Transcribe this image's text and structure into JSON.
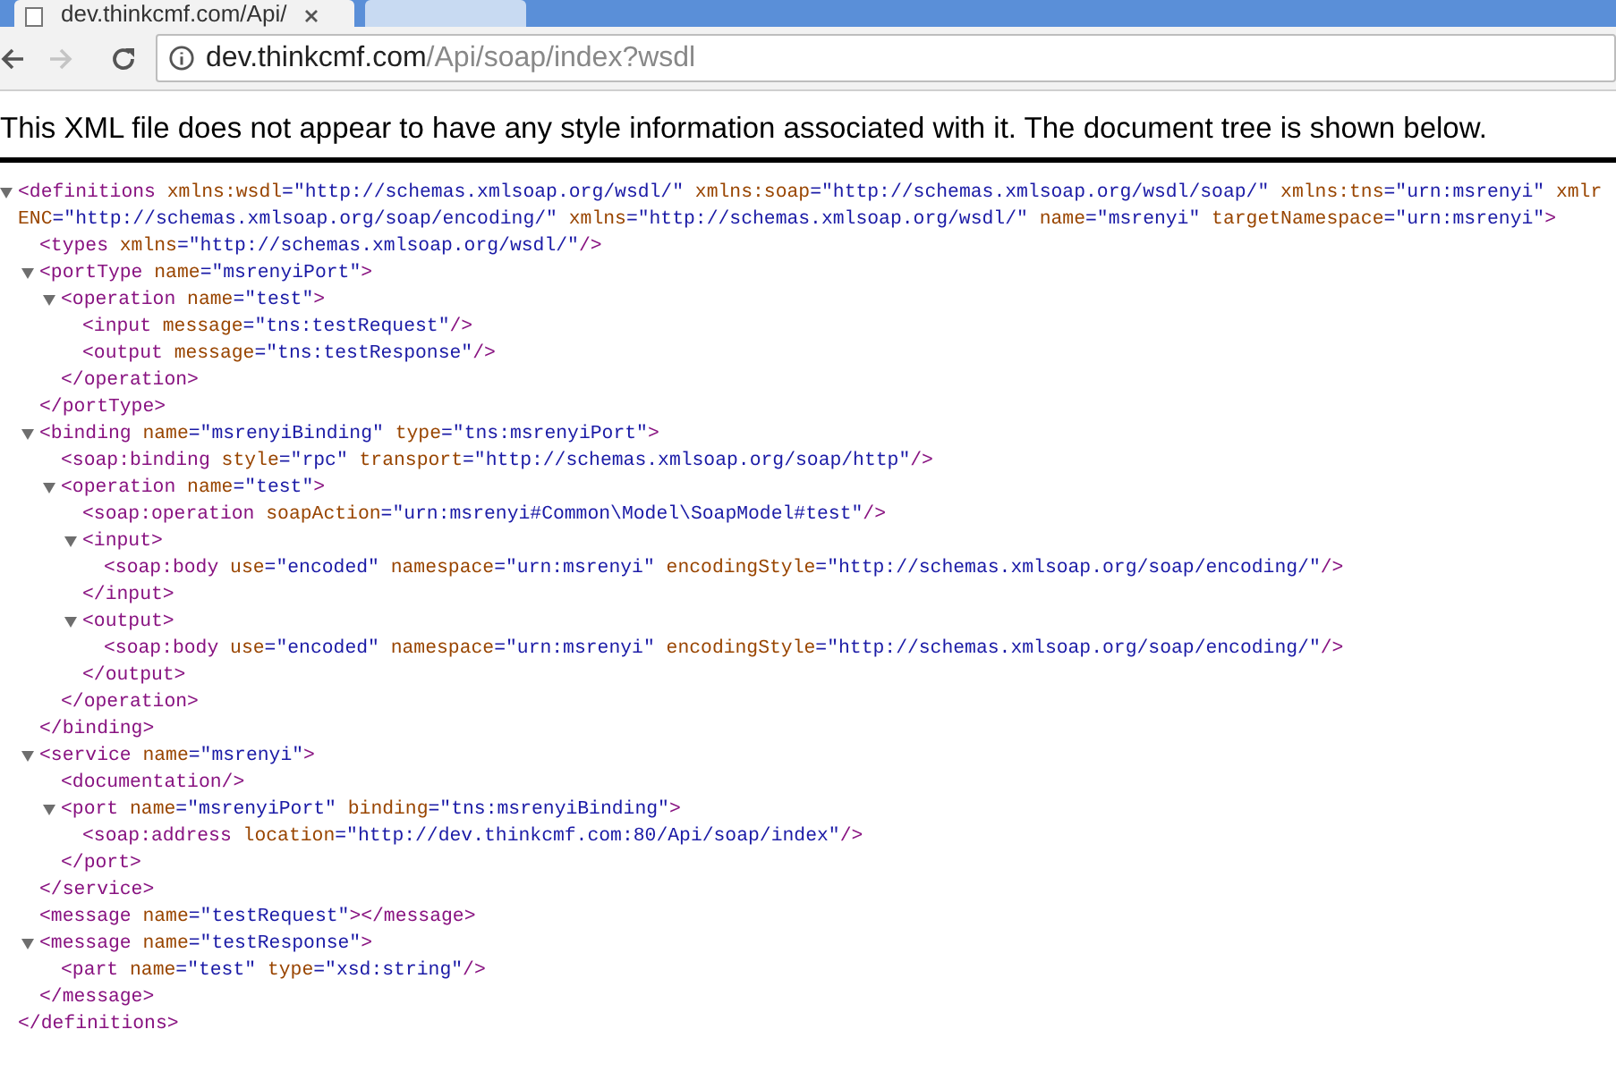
{
  "tab": {
    "title": "dev.thinkcmf.com/Api/"
  },
  "address_bar": {
    "host": "dev.thinkcmf.com",
    "path": "/Api/soap/index?wsdl"
  },
  "navigation": {
    "back_disabled": false,
    "forward_disabled": true
  },
  "notice": "This XML file does not appear to have any style information associated with it. The document tree is shown below.",
  "xml_tree": [
    {
      "tag_open": "<definitions",
      "attributes": [
        {
          "name": "xmlns:wsdl",
          "value": "=\"http://schemas.xmlsoap.org/wsdl/\"",
          "line_break": false
        },
        {
          "name": "xmlns:soap",
          "value": "=\"http://schemas.xmlsoap.org/wsdl/soap/\"",
          "line_break": false
        },
        {
          "name": "xmlns:tns",
          "value": "=\"urn:msrenyi\"",
          "line_break": false
        },
        {
          "name": "xmlr",
          "line_break": false
        },
        {
          "name": "ENC",
          "value": "=\"http://schemas.xmlsoap.org/soap/encoding/\"",
          "line_break": true
        },
        {
          "name": "xmlns",
          "value": "=\"http://schemas.xmlsoap.org/wsdl/\"",
          "line_break": false
        },
        {
          "name": "name",
          "value": "=\"msrenyi\"",
          "line_break": false
        },
        {
          "name": "targetNamespace",
          "value": "=\"urn:msrenyi\"",
          "line_break": false
        }
      ],
      "tag_end": ">",
      "expanded": true,
      "close": "</definitions>",
      "children": [
        {
          "tag_open": "<types",
          "attributes": [
            {
              "name": "xmlns",
              "value": "=\"http://schemas.xmlsoap.org/wsdl/\"",
              "line_break": false
            }
          ],
          "tag_end": "/>"
        },
        {
          "tag_open": "<portType",
          "attributes": [
            {
              "name": "name",
              "value": "=\"msrenyiPort\"",
              "line_break": false
            }
          ],
          "tag_end": ">",
          "expanded": true,
          "close": "</portType>",
          "children": [
            {
              "tag_open": "<operation",
              "attributes": [
                {
                  "name": "name",
                  "value": "=\"test\"",
                  "line_break": false
                }
              ],
              "tag_end": ">",
              "expanded": true,
              "close": "</operation>",
              "children": [
                {
                  "tag_open": "<input",
                  "attributes": [
                    {
                      "name": "message",
                      "value": "=\"tns:testRequest\"",
                      "line_break": false
                    }
                  ],
                  "tag_end": "/>"
                },
                {
                  "tag_open": "<output",
                  "attributes": [
                    {
                      "name": "message",
                      "value": "=\"tns:testResponse\"",
                      "line_break": false
                    }
                  ],
                  "tag_end": "/>"
                }
              ]
            }
          ]
        },
        {
          "tag_open": "<binding",
          "attributes": [
            {
              "name": "name",
              "value": "=\"msrenyiBinding\"",
              "line_break": false
            },
            {
              "name": "type",
              "value": "=\"tns:msrenyiPort\"",
              "line_break": false
            }
          ],
          "tag_end": ">",
          "expanded": true,
          "close": "</binding>",
          "children": [
            {
              "tag_open": "<soap:binding",
              "attributes": [
                {
                  "name": "style",
                  "value": "=\"rpc\"",
                  "line_break": false
                },
                {
                  "name": "transport",
                  "value": "=\"http://schemas.xmlsoap.org/soap/http\"",
                  "line_break": false
                }
              ],
              "tag_end": "/>"
            },
            {
              "tag_open": "<operation",
              "attributes": [
                {
                  "name": "name",
                  "value": "=\"test\"",
                  "line_break": false
                }
              ],
              "tag_end": ">",
              "expanded": true,
              "close": "</operation>",
              "children": [
                {
                  "tag_open": "<soap:operation",
                  "attributes": [
                    {
                      "name": "soapAction",
                      "value": "=\"urn:msrenyi#Common\\Model\\SoapModel#test\"",
                      "line_break": false
                    }
                  ],
                  "tag_end": "/>"
                },
                {
                  "tag_open": "<input",
                  "tag_end": ">",
                  "expanded": true,
                  "close": "</input>",
                  "children": [
                    {
                      "tag_open": "<soap:body",
                      "attributes": [
                        {
                          "name": "use",
                          "value": "=\"encoded\"",
                          "line_break": false
                        },
                        {
                          "name": "namespace",
                          "value": "=\"urn:msrenyi\"",
                          "line_break": false
                        },
                        {
                          "name": "encodingStyle",
                          "value": "=\"http://schemas.xmlsoap.org/soap/encoding/\"",
                          "line_break": false
                        }
                      ],
                      "tag_end": "/>"
                    }
                  ]
                },
                {
                  "tag_open": "<output",
                  "tag_end": ">",
                  "expanded": true,
                  "close": "</output>",
                  "children": [
                    {
                      "tag_open": "<soap:body",
                      "attributes": [
                        {
                          "name": "use",
                          "value": "=\"encoded\"",
                          "line_break": false
                        },
                        {
                          "name": "namespace",
                          "value": "=\"urn:msrenyi\"",
                          "line_break": false
                        },
                        {
                          "name": "encodingStyle",
                          "value": "=\"http://schemas.xmlsoap.org/soap/encoding/\"",
                          "line_break": false
                        }
                      ],
                      "tag_end": "/>"
                    }
                  ]
                }
              ]
            }
          ]
        },
        {
          "tag_open": "<service",
          "attributes": [
            {
              "name": "name",
              "value": "=\"msrenyi\"",
              "line_break": false
            }
          ],
          "tag_end": ">",
          "expanded": true,
          "close": "</service>",
          "children": [
            {
              "tag_open": "<documentation",
              "tag_end": "/>"
            },
            {
              "tag_open": "<port",
              "attributes": [
                {
                  "name": "name",
                  "value": "=\"msrenyiPort\"",
                  "line_break": false
                },
                {
                  "name": "binding",
                  "value": "=\"tns:msrenyiBinding\"",
                  "line_break": false
                }
              ],
              "tag_end": ">",
              "expanded": true,
              "close": "</port>",
              "children": [
                {
                  "tag_open": "<soap:address",
                  "attributes": [
                    {
                      "name": "location",
                      "value": "=\"http://dev.thinkcmf.com:80/Api/soap/index\"",
                      "line_break": false
                    }
                  ],
                  "tag_end": "/>"
                }
              ]
            }
          ]
        },
        {
          "tag_open": "<message",
          "attributes": [
            {
              "name": "name",
              "value": "=\"testRequest\"",
              "line_break": false
            }
          ],
          "tag_end": ">",
          "close": "</message>"
        },
        {
          "tag_open": "<message",
          "attributes": [
            {
              "name": "name",
              "value": "=\"testResponse\"",
              "line_break": false
            }
          ],
          "tag_end": ">",
          "expanded": true,
          "close": "</message>",
          "children": [
            {
              "tag_open": "<part",
              "attributes": [
                {
                  "name": "name",
                  "value": "=\"test\"",
                  "line_break": false
                },
                {
                  "name": "type",
                  "value": "=\"xsd:string\"",
                  "line_break": false
                }
              ],
              "tag_end": "/>"
            }
          ]
        }
      ]
    }
  ]
}
